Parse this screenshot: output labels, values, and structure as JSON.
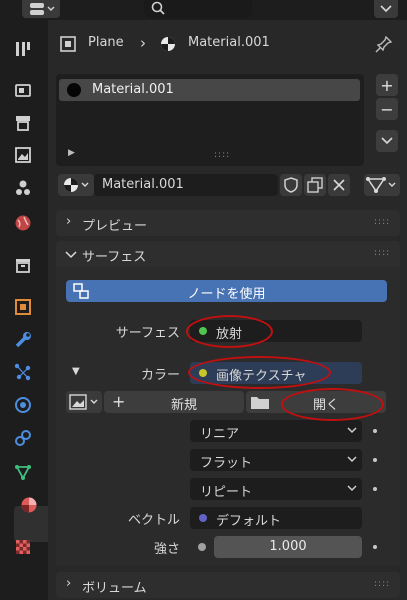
{
  "breadcrumb": {
    "object": "Plane",
    "material": "Material.001"
  },
  "material_slots": [
    {
      "name": "Material.001"
    }
  ],
  "material_selector": {
    "name": "Material.001"
  },
  "panels": {
    "preview": "プレビュー",
    "surface": "サーフェス",
    "volume": "ボリューム"
  },
  "use_nodes_button": "ノードを使用",
  "surface_row": {
    "label": "サーフェス",
    "value": "放射"
  },
  "color_row": {
    "label": "カラー",
    "value": "画像テクスチャ"
  },
  "image_row": {
    "new_label": "新規",
    "open_label": "開く"
  },
  "dropdowns": {
    "interpolation": "リニア",
    "projection": "フラット",
    "extension": "リピート"
  },
  "vector_row": {
    "label": "ベクトル",
    "value": "デフォルト"
  },
  "strength_row": {
    "label": "強さ",
    "value": "1.000"
  },
  "colors": {
    "accent_blue": "#4772b3",
    "annotation_red": "#c01010",
    "surface_socket": "#4fc54f",
    "color_socket": "#c7c729",
    "vector_socket": "#6363c7",
    "float_socket": "#a1a1a1"
  },
  "icons": [
    "editor-type-icon",
    "search-icon",
    "collapse-icon",
    "tool-icon",
    "render-icon",
    "output-icon",
    "view-layer-icon",
    "scene-icon",
    "world-icon",
    "collection-icon",
    "object-icon",
    "modifier-icon",
    "particles-icon",
    "physics-icon",
    "constraints-icon",
    "object-data-icon",
    "material-icon",
    "texture-icon",
    "pin-icon",
    "shield-icon",
    "copy-icon",
    "close-icon",
    "node-tree-icon",
    "folder-icon",
    "image-icon"
  ]
}
